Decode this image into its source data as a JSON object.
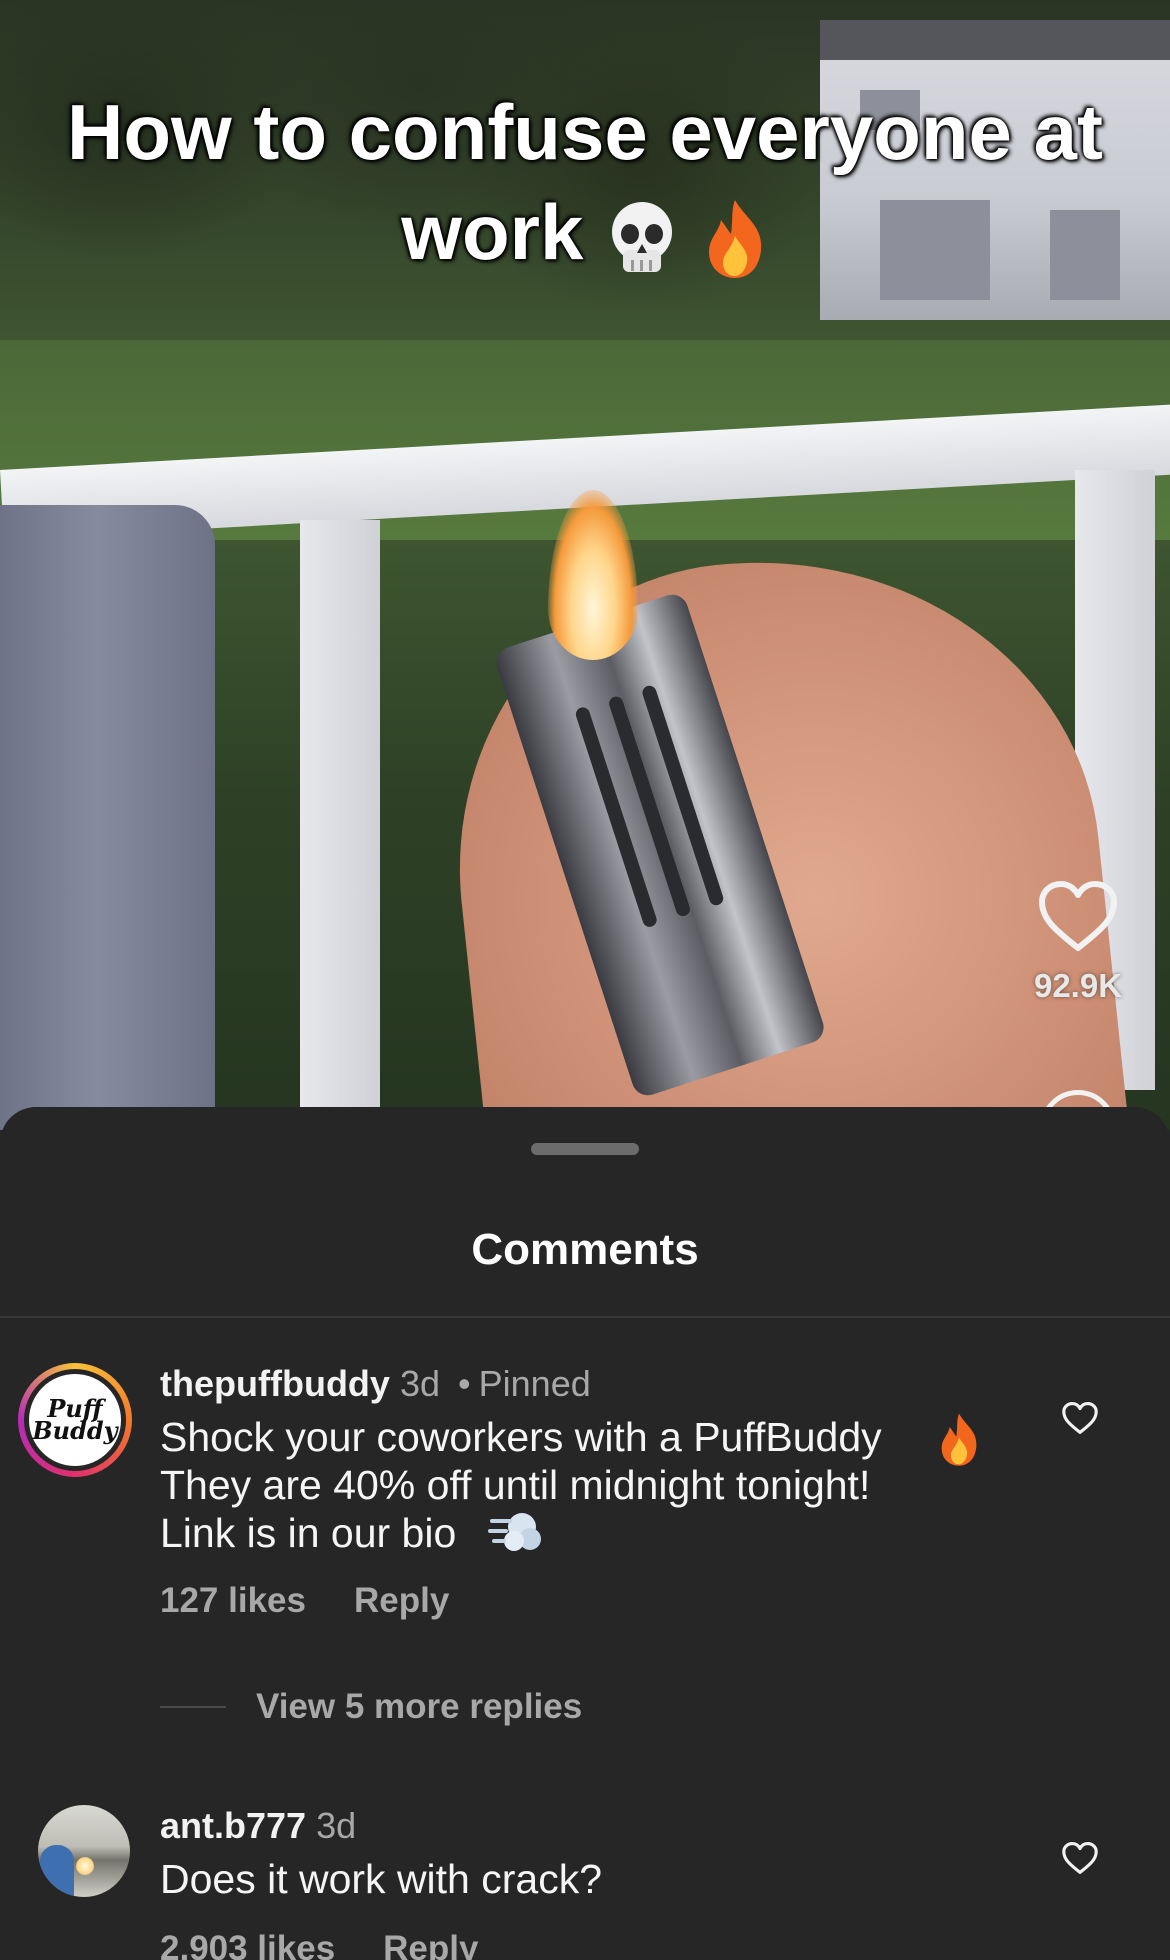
{
  "video": {
    "caption_line1": "How to confuse everyone at",
    "caption_line2": "work",
    "caption_emojis": [
      "skull-emoji",
      "fire-emoji"
    ],
    "like_count": "92.9K"
  },
  "comments_sheet": {
    "title": "Comments",
    "comments": [
      {
        "username": "thepuffbuddy",
        "time": "3d",
        "pinned_label": "Pinned",
        "avatar_text": [
          "Puff",
          "Buddy"
        ],
        "text": "Shock your coworkers with a PuffBuddy\nThey are 40% off until midnight tonight!\nLink is in our bio",
        "likes": "127 likes",
        "reply_label": "Reply",
        "view_more": "View 5 more replies"
      },
      {
        "username": "ant.b777",
        "time": "3d",
        "text": "Does it work with crack?",
        "likes": "2,903 likes",
        "reply_label": "Reply"
      }
    ]
  },
  "colors": {
    "sheet_bg": "#262626",
    "primary_text": "#f5f5f5",
    "secondary_text": "#a8a8a8"
  }
}
